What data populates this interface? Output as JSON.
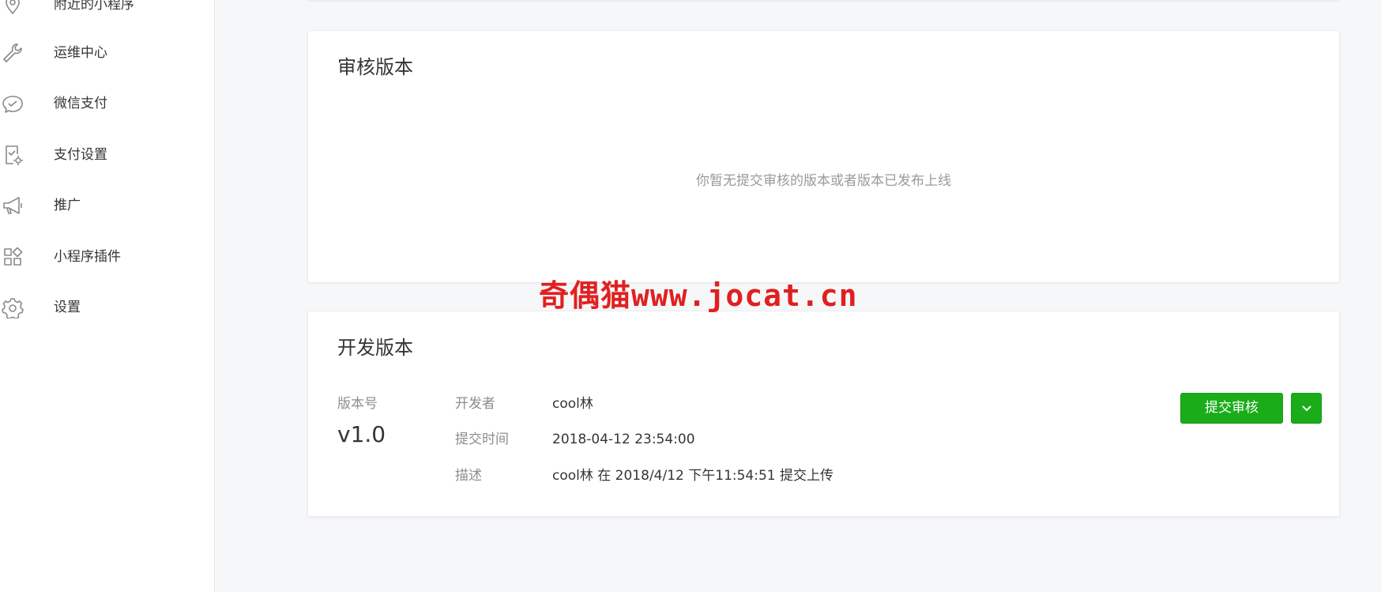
{
  "sidebar": {
    "items": [
      {
        "label": "附近的小程序",
        "icon": "location-pin-icon"
      },
      {
        "label": "运维中心",
        "icon": "wrench-icon"
      },
      {
        "label": "微信支付",
        "icon": "wechat-pay-icon"
      },
      {
        "label": "支付设置",
        "icon": "payment-settings-icon"
      },
      {
        "label": "推广",
        "icon": "megaphone-icon"
      },
      {
        "label": "小程序插件",
        "icon": "plugin-grid-icon"
      },
      {
        "label": "设置",
        "icon": "gear-icon"
      }
    ]
  },
  "review_section": {
    "title": "审核版本",
    "empty_text": "你暂无提交审核的版本或者版本已发布上线"
  },
  "dev_section": {
    "title": "开发版本",
    "version_label": "版本号",
    "version": "v1.0",
    "developer_label": "开发者",
    "developer": "cool林",
    "submit_time_label": "提交时间",
    "submit_time": "2018-04-12 23:54:00",
    "description_label": "描述",
    "description": "cool林 在 2018/4/12 下午11:54:51 提交上传",
    "submit_button": "提交审核"
  },
  "watermark": "奇偶猫www.jocat.cn",
  "colors": {
    "primary": "#1aad19",
    "watermark": "#e02020",
    "background": "#f6f7f9"
  }
}
